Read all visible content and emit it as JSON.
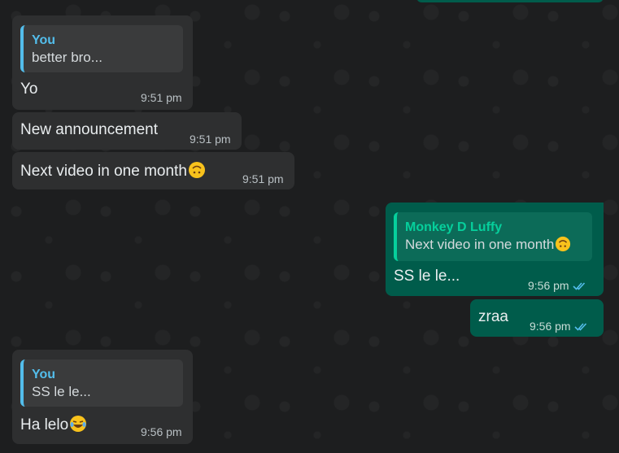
{
  "colors": {
    "incoming_bubble": "#2e2f30",
    "outgoing_bubble": "#005c4b",
    "quote_accent_in": "#53bdeb",
    "quote_accent_out": "#06cf9c",
    "read_ticks": "#53bdeb"
  },
  "messages": [
    {
      "quote_author": "You",
      "quote_text": "better bro...",
      "text": "Yo",
      "time": "9:51 pm"
    },
    {
      "text": "New announcement",
      "time": "9:51 pm"
    },
    {
      "text": "Next video in one month",
      "emoji": "upside-down-face-emoji",
      "time": "9:51 pm"
    },
    {
      "quote_author": "Monkey D Luffy",
      "quote_text": "Next video in one month",
      "quote_emoji": "upside-down-face-emoji",
      "text": "SS le le...",
      "time": "9:56 pm",
      "status": "read-ticks-icon"
    },
    {
      "text": "zraa",
      "time": "9:56 pm",
      "status": "read-ticks-icon"
    },
    {
      "quote_author": "You",
      "quote_text": "SS le le...",
      "text": "Ha lelo",
      "emoji": "joy-face-emoji",
      "time": "9:56 pm"
    }
  ]
}
